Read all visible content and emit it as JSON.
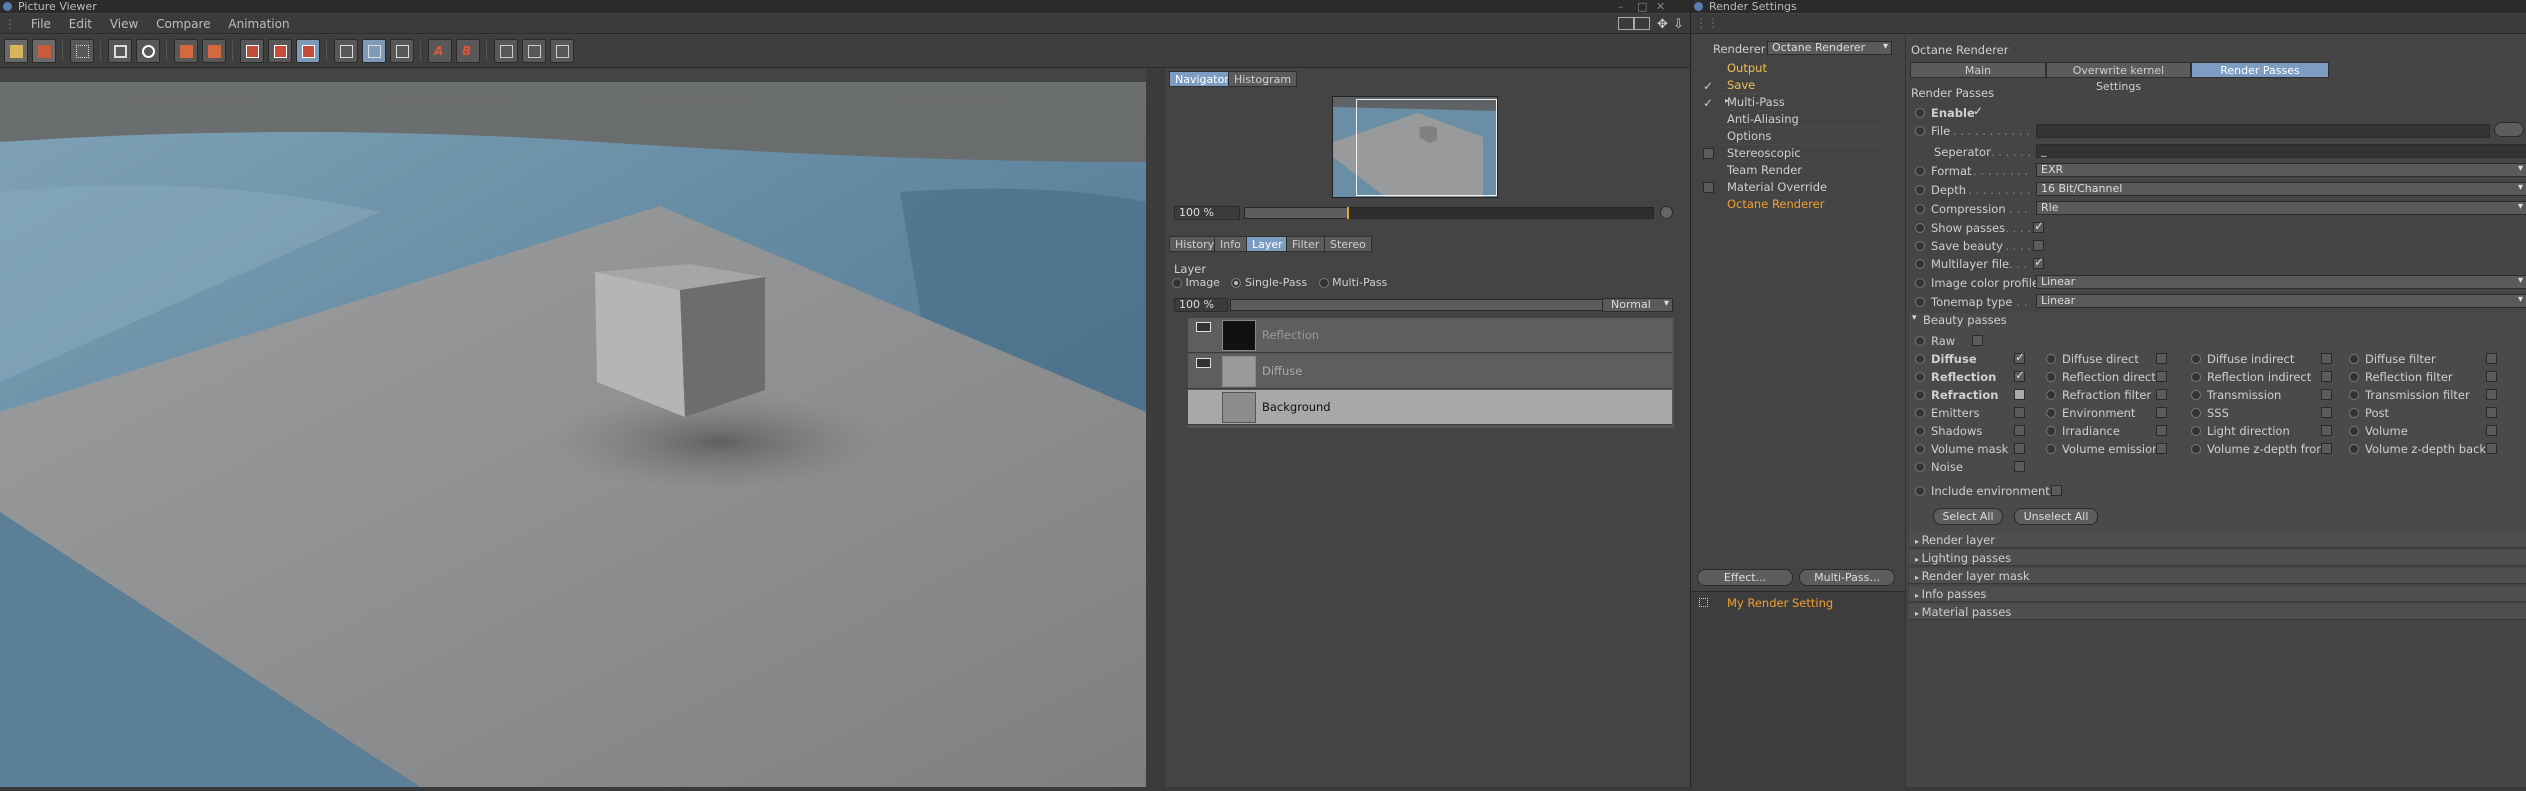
{
  "picture_viewer": {
    "title": "Picture Viewer",
    "menu": [
      "File",
      "Edit",
      "View",
      "Compare",
      "Animation"
    ],
    "navigator_tabs": [
      "Navigator",
      "Histogram"
    ],
    "zoom": "100 %",
    "panel_tabs": [
      "History",
      "Info",
      "Layer",
      "Filter",
      "Stereo"
    ],
    "layer_section": "Layer",
    "modes": [
      "Image",
      "Single-Pass",
      "Multi-Pass"
    ],
    "opacity": "100 %",
    "blend_mode": "Normal",
    "layers": [
      {
        "name": "Reflection"
      },
      {
        "name": "Diffuse"
      },
      {
        "name": "Background"
      }
    ]
  },
  "render_settings": {
    "title": "Render Settings",
    "renderer_label": "Renderer",
    "renderer_value": "Octane Renderer",
    "tree": [
      "Output",
      "Save",
      "Multi-Pass",
      "Anti-Aliasing",
      "Options",
      "Stereoscopic",
      "Team Render",
      "Material Override",
      "Octane Renderer"
    ],
    "effect_button": "Effect...",
    "multipass_button": "Multi-Pass...",
    "render_setting_name": "My Render Setting",
    "panel_title": "Octane Renderer",
    "tabs": [
      "Main",
      "Overwrite kernel Settings",
      "Render Passes"
    ],
    "section_title": "Render Passes",
    "enable_label": "Enable",
    "file_label": "File",
    "separator_label": "Seperator",
    "separator_value": "_",
    "format_label": "Format",
    "format_value": "EXR",
    "depth_label": "Depth",
    "depth_value": "16 Bit/Channel",
    "compression_label": "Compression",
    "compression_value": "Rle",
    "show_passes_label": "Show passes",
    "save_beauty_label": "Save beauty",
    "multilayer_label": "Multilayer file",
    "image_color_profile_label": "Image color profile",
    "image_color_profile_value": "Linear",
    "tonemap_label": "Tonemap type",
    "tonemap_value": "Linear",
    "beauty_title": "Beauty passes",
    "raw_label": "Raw",
    "beauty_col1": [
      "Diffuse",
      "Reflection",
      "Refraction",
      "Emitters",
      "Shadows",
      "Volume mask",
      "Noise"
    ],
    "beauty_col2": [
      "Diffuse direct",
      "Reflection direct",
      "Refraction filter",
      "Environment",
      "Irradiance",
      "Volume emission"
    ],
    "beauty_col3": [
      "Diffuse indirect",
      "Reflection indirect",
      "Transmission",
      "SSS",
      "Light direction",
      "Volume z-depth front"
    ],
    "beauty_col4": [
      "Diffuse filter",
      "Reflection filter",
      "Transmission filter",
      "Post",
      "Volume",
      "Volume z-depth back"
    ],
    "include_env_label": "Include environment",
    "select_all": "Select All",
    "unselect_all": "Unselect All",
    "collapsed_sections": [
      "Render layer",
      "Lighting passes",
      "Render layer mask",
      "Info passes",
      "Material passes"
    ]
  }
}
